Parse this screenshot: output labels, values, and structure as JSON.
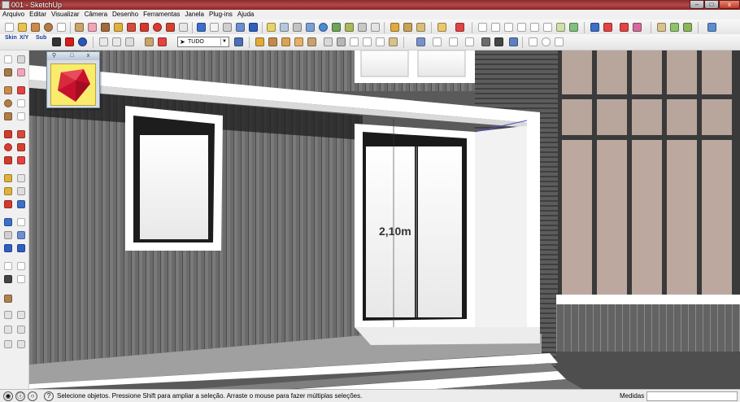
{
  "window": {
    "title": "001 - SketchUp",
    "min_label": "–",
    "max_label": "□",
    "close_label": "x"
  },
  "menu": [
    "Arquivo",
    "Editar",
    "Visualizar",
    "Câmera",
    "Desenho",
    "Ferramentas",
    "Janela",
    "Plug-ins",
    "Ajuda"
  ],
  "toolbar": {
    "layer_combo_value": "TUDO",
    "skin_label": "Skin",
    "xyz_label": "X/Y",
    "sub_label": "Sub"
  },
  "ruby_panel": {
    "pin_label": "⚲",
    "max_label": "□",
    "close_label": "x"
  },
  "viewport": {
    "dimension_label": "2,10m"
  },
  "status": {
    "message": "Selecione objetos. Pressione Shift para ampliar a seleção. Arraste o mouse para fazer múltiplas seleções.",
    "measure_label": "Medidas",
    "measure_value": ""
  },
  "colors": {
    "title_bar": "#a33a3a",
    "wall_dark": "#6a6a6a",
    "glass_tile": "#b9a39a",
    "frame_white": "#ffffff",
    "ruby_bg": "#f9ec6c",
    "ruby_gem": "#c8102e"
  }
}
